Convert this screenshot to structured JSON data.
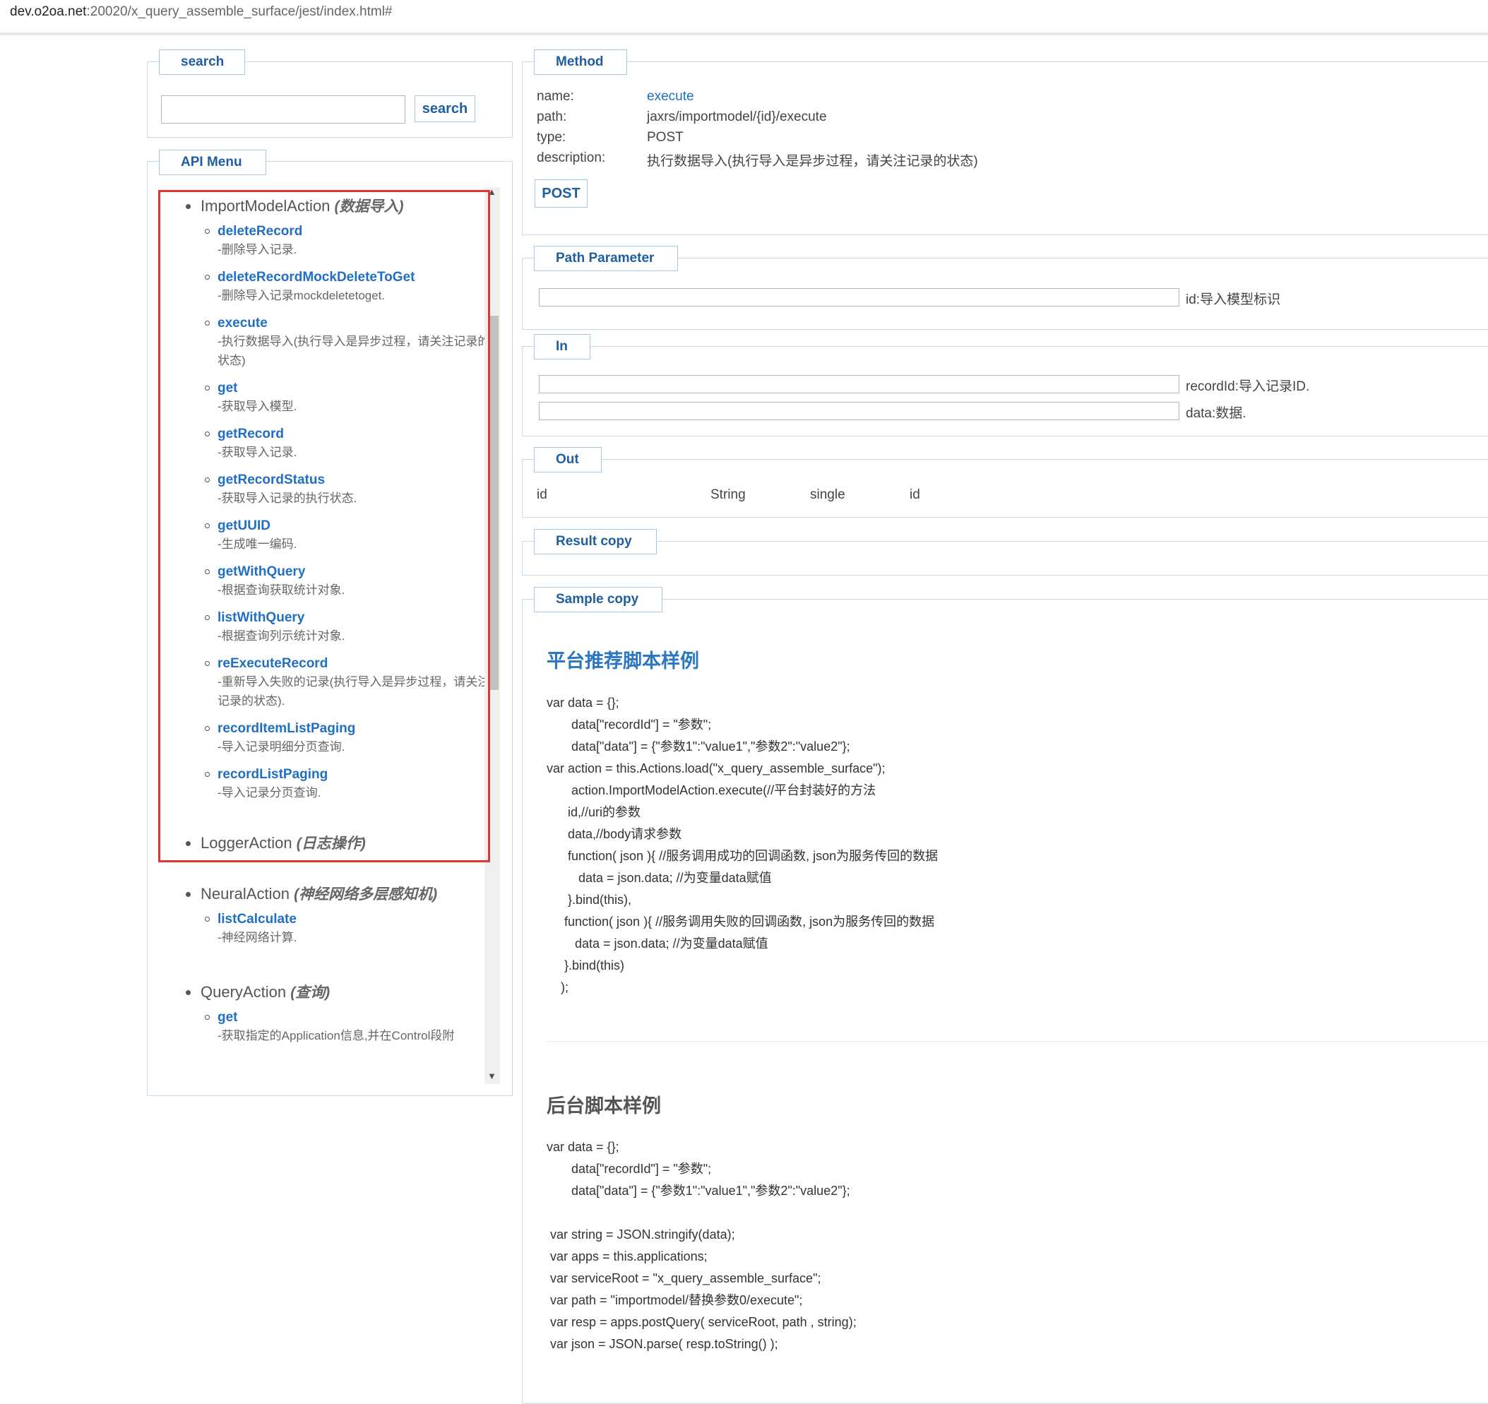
{
  "browser": {
    "url_host": "dev.o2oa.net",
    "url_rest": ":20020/x_query_assemble_surface/jest/index.html#"
  },
  "search": {
    "legend": "search",
    "button": "search",
    "input_value": ""
  },
  "api_menu": {
    "legend": "API Menu",
    "groups": [
      {
        "name": "ImportModelAction",
        "cn": "(数据导入)",
        "items": [
          {
            "name": "deleteRecord",
            "desc": "-删除导入记录."
          },
          {
            "name": "deleteRecordMockDeleteToGet",
            "desc": "-删除导入记录mockdeletetoget."
          },
          {
            "name": "execute",
            "desc": "-执行数据导入(执行导入是异步过程，请关注记录的状态)"
          },
          {
            "name": "get",
            "desc": "-获取导入模型."
          },
          {
            "name": "getRecord",
            "desc": "-获取导入记录."
          },
          {
            "name": "getRecordStatus",
            "desc": "-获取导入记录的执行状态."
          },
          {
            "name": "getUUID",
            "desc": "-生成唯一编码."
          },
          {
            "name": "getWithQuery",
            "desc": "-根据查询获取统计对象."
          },
          {
            "name": "listWithQuery",
            "desc": "-根据查询列示统计对象."
          },
          {
            "name": "reExecuteRecord",
            "desc": "-重新导入失败的记录(执行导入是异步过程，请关注记录的状态)."
          },
          {
            "name": "recordItemListPaging",
            "desc": "-导入记录明细分页查询."
          },
          {
            "name": "recordListPaging",
            "desc": "-导入记录分页查询."
          }
        ]
      },
      {
        "name": "LoggerAction",
        "cn": "(日志操作)",
        "items": []
      },
      {
        "name": "NeuralAction",
        "cn": "(神经网络多层感知机)",
        "items": [
          {
            "name": "listCalculate",
            "desc": "-神经网络计算."
          }
        ]
      },
      {
        "name": "QueryAction",
        "cn": "(查询)",
        "items": [
          {
            "name": "get",
            "desc": "-获取指定的Application信息,并在Control段附"
          }
        ]
      }
    ]
  },
  "method": {
    "legend": "Method",
    "name_label": "name:",
    "name_value": "execute",
    "path_label": "path:",
    "path_value": "jaxrs/importmodel/{id}/execute",
    "type_label": "type:",
    "type_value": "POST",
    "desc_label": "description:",
    "desc_value": "执行数据导入(执行导入是异步过程，请关注记录的状态)",
    "button": "POST"
  },
  "path_parameter": {
    "legend": "Path Parameter",
    "fields": [
      {
        "label": "id:导入模型标识"
      }
    ]
  },
  "in": {
    "legend": "In",
    "fields": [
      {
        "label": "recordId:导入记录ID."
      },
      {
        "label": "data:数据."
      }
    ]
  },
  "out": {
    "legend": "Out",
    "row": [
      "id",
      "String",
      "single",
      "id"
    ]
  },
  "result": {
    "legend": "Result copy"
  },
  "sample": {
    "legend": "Sample copy",
    "platform_title": "平台推荐脚本样例",
    "platform_code": [
      "var data = {};",
      "       data[\"recordId\"] = \"参数\";",
      "       data[\"data\"] = {\"参数1\":\"value1\",\"参数2\":\"value2\"};",
      "var action = this.Actions.load(\"x_query_assemble_surface\");",
      "       action.ImportModelAction.execute(//平台封装好的方法",
      "      id,//uri的参数",
      "      data,//body请求参数",
      "      function( json ){ //服务调用成功的回调函数, json为服务传回的数据",
      "         data = json.data; //为变量data赋值",
      "      }.bind(this),",
      "     function( json ){ //服务调用失败的回调函数, json为服务传回的数据",
      "        data = json.data; //为变量data赋值",
      "     }.bind(this)",
      "    );"
    ],
    "backend_title": "后台脚本样例",
    "backend_code": [
      "var data = {};",
      "       data[\"recordId\"] = \"参数\";",
      "       data[\"data\"] = {\"参数1\":\"value1\",\"参数2\":\"value2\"};",
      "",
      " var string = JSON.stringify(data);",
      " var apps = this.applications;",
      " var serviceRoot = \"x_query_assemble_surface\";",
      " var path = \"importmodel/替换参数0/execute\";",
      " var resp = apps.postQuery( serviceRoot, path , string);",
      " var json = JSON.parse( resp.toString() );"
    ]
  }
}
